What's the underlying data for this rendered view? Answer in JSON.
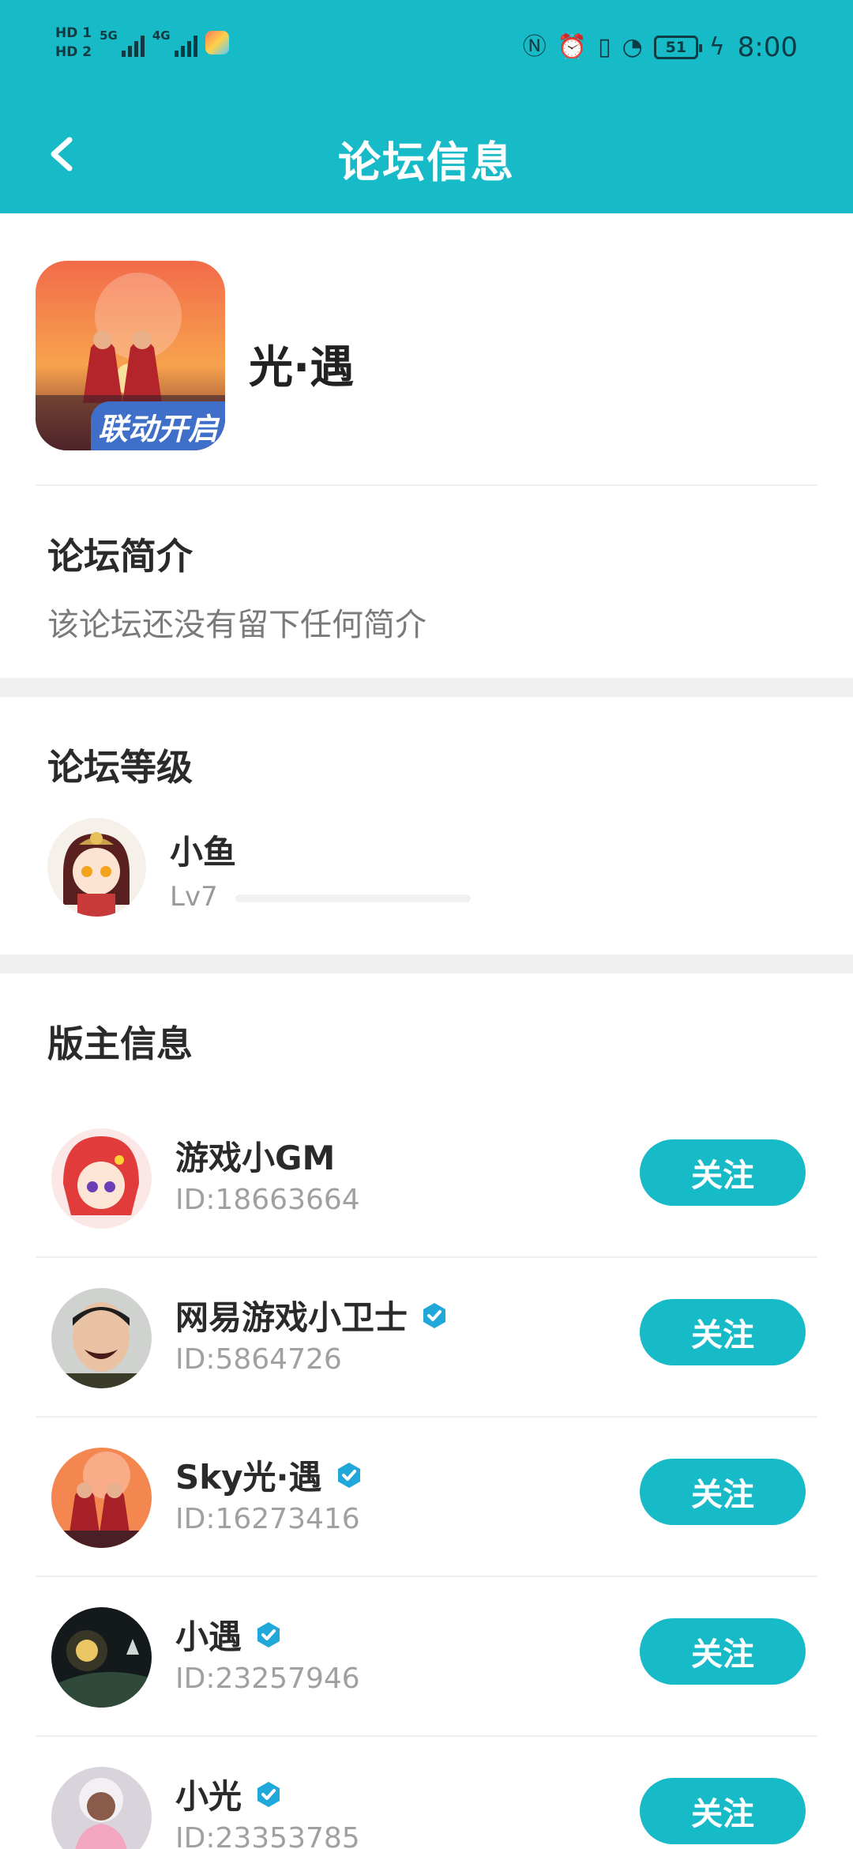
{
  "status_bar": {
    "sim1": "HD 1",
    "sim2": "HD 2",
    "net1": "5G",
    "net2": "4G",
    "battery": "51",
    "time": "8:00",
    "icons": [
      "nfc-icon",
      "alarm-icon",
      "vibrate-icon",
      "speed-icon",
      "battery-icon",
      "charging-icon"
    ]
  },
  "nav": {
    "title": "论坛信息",
    "back_icon": "chevron-left-icon"
  },
  "forum": {
    "name": "光·遇",
    "icon_badge": "联动开启"
  },
  "intro": {
    "title": "论坛简介",
    "text": "该论坛还没有留下任何简介"
  },
  "level": {
    "title": "论坛等级",
    "name": "小鱼",
    "lv": "Lv7",
    "progress": 0
  },
  "moderators": {
    "title": "版主信息",
    "follow_label": "关注",
    "items": [
      {
        "name": "游戏小GM",
        "id": "ID:18663664",
        "verified": false
      },
      {
        "name": "网易游戏小卫士",
        "id": "ID:5864726",
        "verified": true
      },
      {
        "name": "Sky光·遇",
        "id": "ID:16273416",
        "verified": true
      },
      {
        "name": "小遇",
        "id": "ID:23257946",
        "verified": true
      },
      {
        "name": "小光",
        "id": "ID:23353785",
        "verified": true
      }
    ]
  },
  "colors": {
    "accent": "#17bac7",
    "text_dark": "#2a2a2a",
    "text_muted": "#a0a0a0",
    "band": "#efefef"
  }
}
